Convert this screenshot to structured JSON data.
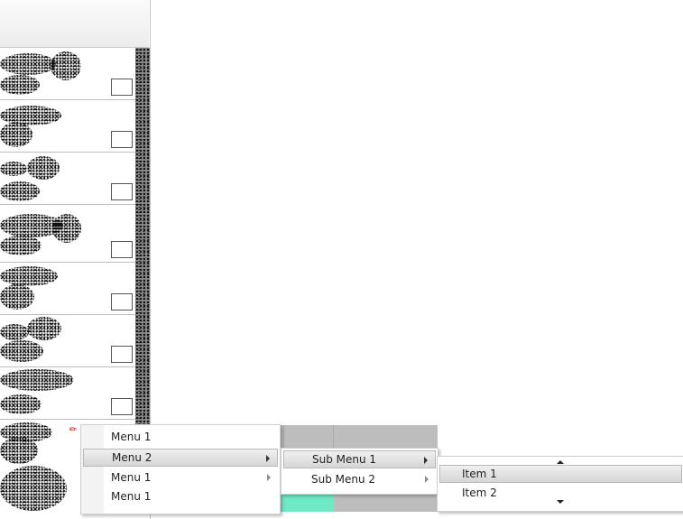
{
  "menu_main": {
    "items": [
      {
        "label": "Menu 1"
      },
      {
        "label": "Menu 2"
      },
      {
        "label": "Menu 1"
      },
      {
        "label": "Menu 1"
      }
    ]
  },
  "menu_sub": {
    "items": [
      {
        "label": "Sub Menu 1"
      },
      {
        "label": "Sub Menu 2"
      }
    ]
  },
  "menu_items": {
    "items": [
      {
        "label": "Item 1"
      },
      {
        "label": "Item 2"
      }
    ]
  },
  "icons": {
    "submenu_arrow": "chevron-right-icon",
    "scroll_up": "scroll-up-icon",
    "scroll_down": "scroll-down-icon",
    "gallery_checkbox": "checkbox-icon"
  },
  "colors": {
    "highlight_teal": "#6fe8c4",
    "menu_highlight": "#d6d6d6",
    "panel_gray": "#bdbdbd"
  }
}
